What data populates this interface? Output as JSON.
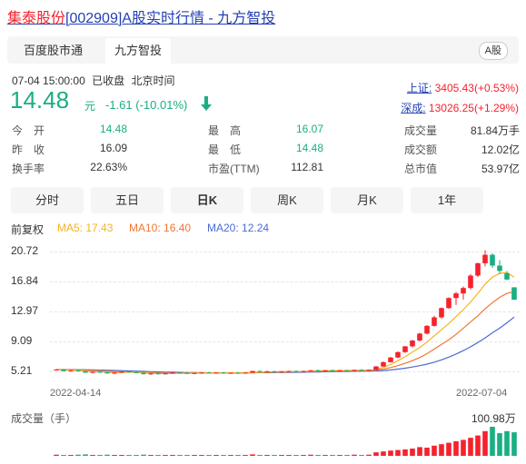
{
  "header": {
    "name": "集泰股份",
    "code": "[002909]",
    "suffix": "A股实时行情 - 九方智投"
  },
  "tabs": [
    {
      "label": "百度股市通",
      "active": false
    },
    {
      "label": "九方智投",
      "active": true
    }
  ],
  "market_badge": "A股",
  "quote": {
    "datetime": "07-04 15:00:00",
    "status": "已收盘",
    "timezone": "北京时间",
    "price": "14.48",
    "unit": "元",
    "change": "-1.61",
    "change_pct": "(-10.01%)"
  },
  "indices": [
    {
      "name": "上证:",
      "value": "3405.43(+0.53%)"
    },
    {
      "name": "深成:",
      "value": "13026.25(+1.29%)"
    }
  ],
  "stats": {
    "col1": [
      {
        "label": "今　开",
        "value": "14.48"
      },
      {
        "label": "昨　收",
        "value": "16.09"
      },
      {
        "label": "换手率",
        "value": "22.63%"
      }
    ],
    "col2": [
      {
        "label": "最　高",
        "value": "16.07"
      },
      {
        "label": "最　低",
        "value": "14.48"
      },
      {
        "label": "市盈(TTM)",
        "value": "112.81"
      }
    ],
    "col3": [
      {
        "label": "成交量",
        "value": "81.84万手"
      },
      {
        "label": "成交额",
        "value": "12.02亿"
      },
      {
        "label": "总市值",
        "value": "53.97亿"
      }
    ]
  },
  "periods": [
    {
      "label": "分时",
      "active": false
    },
    {
      "label": "五日",
      "active": false
    },
    {
      "label": "日K",
      "active": true
    },
    {
      "label": "周K",
      "active": false
    },
    {
      "label": "月K",
      "active": false
    },
    {
      "label": "1年",
      "active": false
    }
  ],
  "ma": {
    "adjust": "前复权",
    "ma5": "MA5: 17.43",
    "ma10": "MA10: 16.40",
    "ma20": "MA20: 12.24"
  },
  "colors": {
    "up": "#f5222d",
    "down": "#1aae84",
    "ma5": "#f5b323",
    "ma10": "#ee7733",
    "ma20": "#4c6ad6",
    "link": "#2440b3"
  },
  "chart_data": {
    "type": "candlestick",
    "y_ticks": [
      "20.72",
      "16.84",
      "12.97",
      "9.09",
      "5.21"
    ],
    "ylim": [
      5.21,
      20.72
    ],
    "x_labels": [
      "2022-04-14",
      "2022-07-04"
    ],
    "volume_label": "成交量（手）",
    "volume_max_label": "100.98万",
    "candles": [
      [
        5.4,
        5.5,
        5.3,
        5.45
      ],
      [
        5.45,
        5.5,
        5.2,
        5.25
      ],
      [
        5.25,
        5.4,
        5.15,
        5.35
      ],
      [
        5.35,
        5.45,
        5.2,
        5.22
      ],
      [
        5.22,
        5.3,
        5.0,
        5.05
      ],
      [
        5.05,
        5.2,
        4.95,
        5.15
      ],
      [
        5.15,
        5.3,
        5.05,
        5.1
      ],
      [
        5.1,
        5.2,
        4.9,
        4.95
      ],
      [
        4.95,
        5.1,
        4.85,
        5.05
      ],
      [
        5.05,
        5.25,
        5.0,
        5.2
      ],
      [
        5.2,
        5.3,
        5.05,
        5.1
      ],
      [
        5.1,
        5.2,
        4.95,
        5.0
      ],
      [
        5.0,
        5.1,
        4.8,
        4.85
      ],
      [
        4.85,
        5.0,
        4.75,
        4.95
      ],
      [
        4.95,
        5.05,
        4.8,
        4.85
      ],
      [
        4.85,
        5.0,
        4.8,
        4.95
      ],
      [
        4.95,
        5.1,
        4.9,
        5.05
      ],
      [
        5.05,
        5.15,
        4.95,
        5.0
      ],
      [
        5.0,
        5.1,
        4.9,
        4.95
      ],
      [
        4.95,
        5.05,
        4.85,
        5.0
      ],
      [
        5.0,
        5.1,
        4.9,
        5.05
      ],
      [
        5.05,
        5.15,
        4.95,
        5.0
      ],
      [
        5.0,
        5.1,
        4.92,
        5.05
      ],
      [
        5.05,
        5.12,
        4.95,
        4.98
      ],
      [
        4.98,
        5.08,
        4.9,
        5.02
      ],
      [
        5.02,
        5.12,
        4.95,
        5.0
      ],
      [
        5.0,
        5.1,
        4.92,
        5.05
      ],
      [
        5.05,
        5.3,
        5.0,
        5.25
      ],
      [
        5.25,
        5.35,
        5.1,
        5.15
      ],
      [
        5.15,
        5.3,
        5.1,
        5.2
      ],
      [
        5.2,
        5.3,
        5.1,
        5.15
      ],
      [
        5.15,
        5.25,
        5.05,
        5.2
      ],
      [
        5.2,
        5.3,
        5.1,
        5.25
      ],
      [
        5.25,
        5.35,
        5.15,
        5.2
      ],
      [
        5.2,
        5.3,
        5.1,
        5.25
      ],
      [
        5.25,
        5.4,
        5.2,
        5.35
      ],
      [
        5.35,
        5.45,
        5.25,
        5.3
      ],
      [
        5.3,
        5.4,
        5.2,
        5.35
      ],
      [
        5.35,
        5.45,
        5.25,
        5.3
      ],
      [
        5.3,
        5.4,
        5.22,
        5.35
      ],
      [
        5.35,
        5.42,
        5.25,
        5.3
      ],
      [
        5.3,
        5.45,
        5.25,
        5.4
      ],
      [
        5.4,
        5.5,
        5.3,
        5.35
      ],
      [
        5.35,
        5.45,
        5.28,
        5.4
      ],
      [
        5.4,
        5.9,
        5.35,
        5.85
      ],
      [
        5.85,
        6.5,
        5.8,
        6.4
      ],
      [
        6.4,
        7.1,
        6.35,
        7.0
      ],
      [
        7.0,
        7.8,
        6.9,
        7.7
      ],
      [
        7.7,
        8.5,
        7.6,
        8.45
      ],
      [
        8.45,
        9.3,
        8.3,
        9.2
      ],
      [
        9.2,
        10.2,
        9.1,
        10.1
      ],
      [
        10.1,
        11.2,
        10.0,
        11.1
      ],
      [
        11.1,
        12.4,
        11.0,
        12.2
      ],
      [
        12.2,
        13.5,
        12.0,
        13.4
      ],
      [
        13.4,
        14.8,
        13.3,
        14.7
      ],
      [
        14.7,
        15.5,
        13.8,
        15.3
      ],
      [
        15.3,
        16.2,
        14.5,
        16.0
      ],
      [
        16.0,
        17.8,
        15.8,
        17.6
      ],
      [
        17.6,
        19.3,
        17.4,
        19.2
      ],
      [
        19.2,
        20.9,
        18.8,
        20.3
      ],
      [
        20.3,
        20.5,
        18.6,
        18.9
      ],
      [
        18.9,
        19.6,
        17.8,
        18.2
      ],
      [
        17.9,
        18.2,
        17.0,
        17.1
      ],
      [
        16.09,
        16.07,
        14.48,
        14.48
      ]
    ],
    "volumes": [
      0.04,
      0.03,
      0.03,
      0.04,
      0.05,
      0.03,
      0.03,
      0.04,
      0.03,
      0.03,
      0.03,
      0.03,
      0.04,
      0.03,
      0.03,
      0.03,
      0.03,
      0.03,
      0.03,
      0.03,
      0.03,
      0.03,
      0.03,
      0.03,
      0.03,
      0.03,
      0.03,
      0.05,
      0.03,
      0.03,
      0.03,
      0.03,
      0.03,
      0.03,
      0.03,
      0.04,
      0.03,
      0.03,
      0.03,
      0.03,
      0.03,
      0.04,
      0.03,
      0.04,
      0.12,
      0.15,
      0.18,
      0.2,
      0.22,
      0.25,
      0.3,
      0.28,
      0.35,
      0.4,
      0.45,
      0.5,
      0.55,
      0.62,
      0.7,
      0.85,
      1.0,
      0.78,
      0.85,
      0.81
    ],
    "ma5": [
      5.45,
      5.42,
      5.38,
      5.34,
      5.26,
      5.2,
      5.17,
      5.1,
      5.05,
      5.08,
      5.1,
      5.08,
      5.04,
      4.98,
      4.94,
      4.92,
      4.94,
      4.96,
      4.98,
      5.0,
      5.02,
      5.02,
      5.02,
      5.02,
      5.02,
      5.02,
      5.02,
      5.06,
      5.1,
      5.13,
      5.17,
      5.19,
      5.2,
      5.2,
      5.21,
      5.25,
      5.28,
      5.3,
      5.31,
      5.33,
      5.33,
      5.34,
      5.36,
      5.37,
      5.47,
      5.73,
      6.1,
      6.6,
      7.1,
      7.7,
      8.3,
      9.0,
      9.8,
      10.6,
      11.4,
      12.3,
      13.2,
      14.2,
      15.3,
      16.5,
      17.4,
      17.9,
      18.0,
      17.4
    ],
    "ma10": [
      5.45,
      5.44,
      5.42,
      5.4,
      5.36,
      5.32,
      5.28,
      5.24,
      5.19,
      5.15,
      5.12,
      5.1,
      5.08,
      5.05,
      5.02,
      5.0,
      4.99,
      4.99,
      4.99,
      4.99,
      5.0,
      5.0,
      5.01,
      5.01,
      5.01,
      5.02,
      5.02,
      5.04,
      5.06,
      5.08,
      5.1,
      5.12,
      5.14,
      5.16,
      5.18,
      5.2,
      5.22,
      5.24,
      5.26,
      5.28,
      5.29,
      5.3,
      5.32,
      5.33,
      5.38,
      5.5,
      5.7,
      5.95,
      6.25,
      6.6,
      7.0,
      7.5,
      8.1,
      8.7,
      9.3,
      10.0,
      10.8,
      11.6,
      12.4,
      13.3,
      14.1,
      14.8,
      15.3,
      15.5
    ],
    "ma20": [
      5.45,
      5.45,
      5.44,
      5.43,
      5.42,
      5.4,
      5.38,
      5.36,
      5.33,
      5.3,
      5.27,
      5.24,
      5.21,
      5.18,
      5.15,
      5.12,
      5.1,
      5.08,
      5.06,
      5.04,
      5.03,
      5.02,
      5.02,
      5.02,
      5.02,
      5.02,
      5.02,
      5.03,
      5.04,
      5.05,
      5.06,
      5.07,
      5.08,
      5.09,
      5.1,
      5.12,
      5.14,
      5.16,
      5.18,
      5.2,
      5.21,
      5.22,
      5.23,
      5.24,
      5.27,
      5.32,
      5.4,
      5.5,
      5.62,
      5.77,
      5.95,
      6.15,
      6.4,
      6.7,
      7.05,
      7.45,
      7.9,
      8.4,
      8.95,
      9.55,
      10.2,
      10.8,
      11.5,
      12.24
    ]
  }
}
